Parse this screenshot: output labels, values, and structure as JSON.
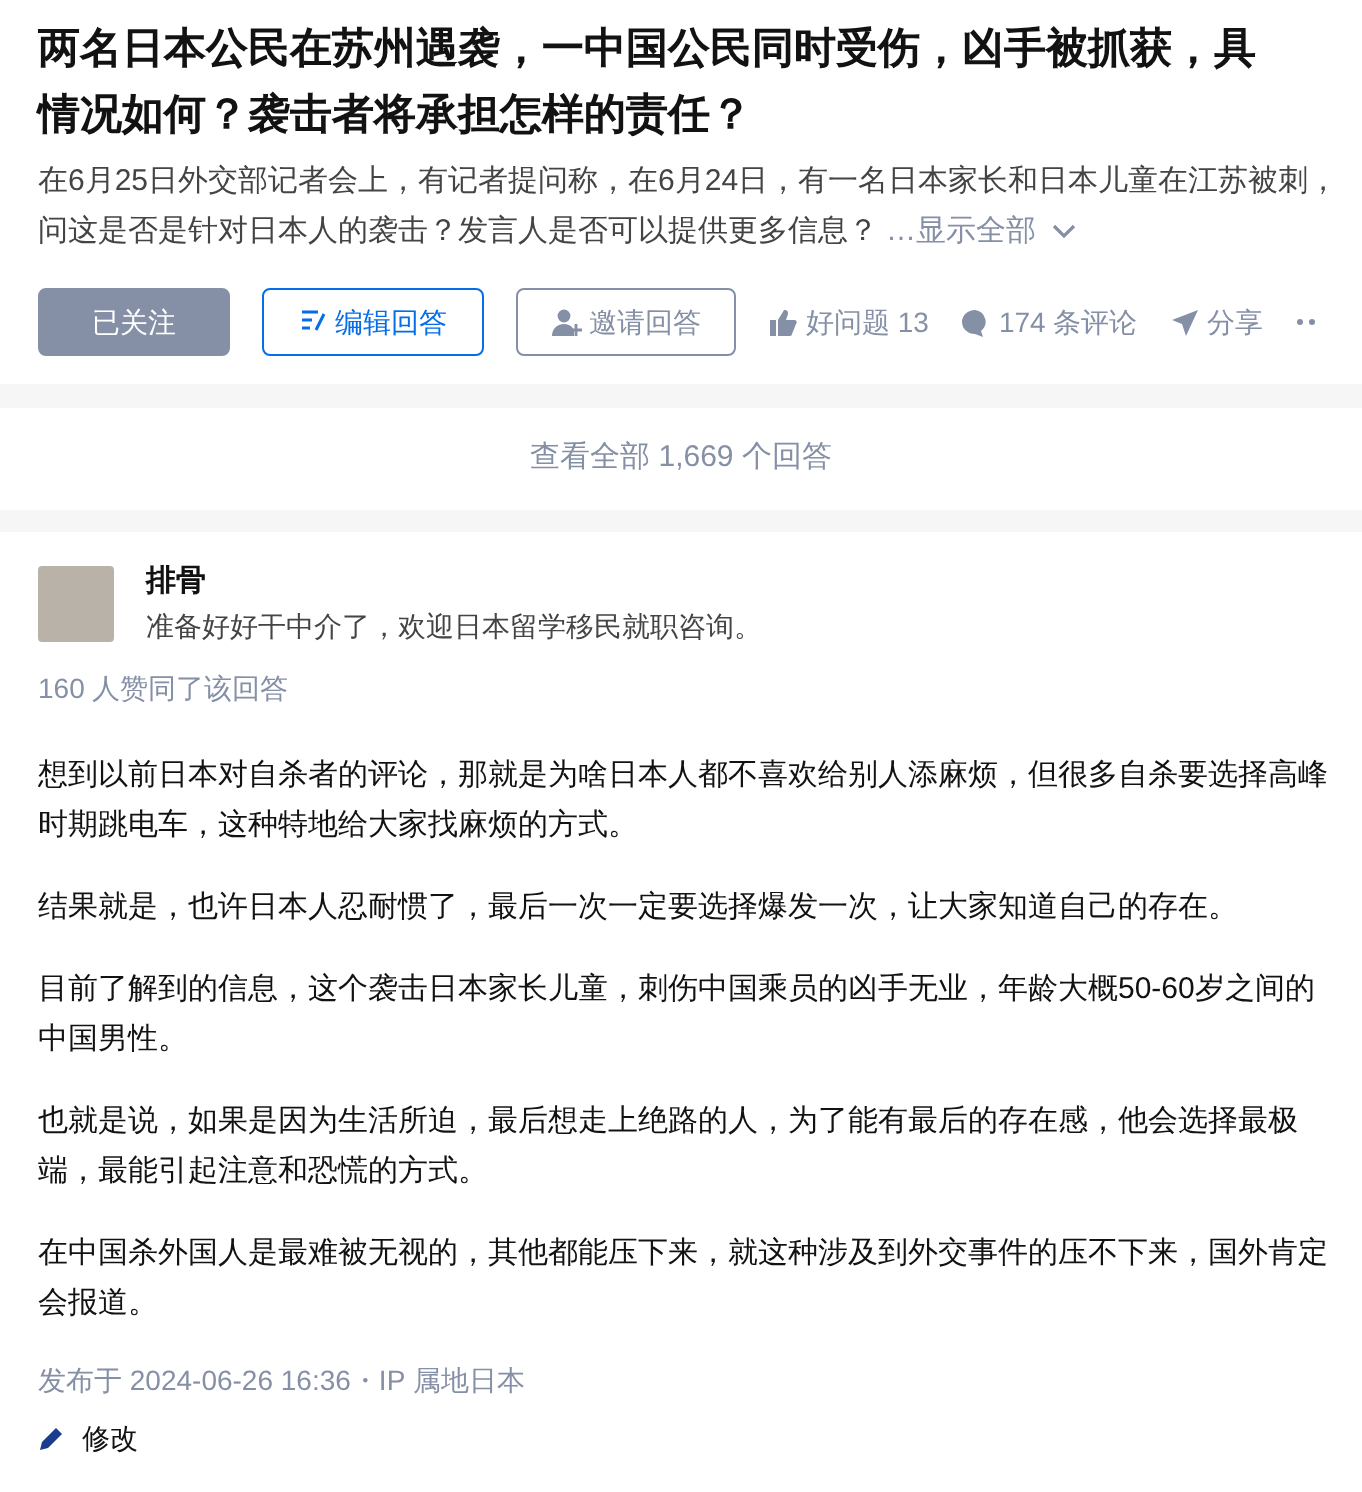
{
  "question": {
    "title_lines": [
      "两名日本公民在苏州遇袭，一中国公民同时受伤，凶手被抓获，具",
      "情况如何？袭击者将承担怎样的责任？"
    ],
    "detail_lines": [
      "在6月25日外交部记者会上，有记者提问称，在6月24日，有一名日本家长和日本儿童在江苏被刺，",
      "问这是否是针对日本人的袭击？发言人是否可以提供更多信息？"
    ],
    "show_all": "…显示全部",
    "follow": {
      "label": "已关注",
      "following": true
    },
    "edit_button": "编辑回答",
    "invite_button": "邀请回答",
    "actions": [
      {
        "kind": "like",
        "label": "好问题 13"
      },
      {
        "kind": "comment",
        "label": "174 条评论"
      },
      {
        "kind": "share",
        "label": "分享"
      }
    ]
  },
  "view_all": "查看全部 1,669 个回答",
  "answer": {
    "author": "排骨",
    "bio": "准备好好干中介了，欢迎日本留学移民就职咨询。",
    "votes": "160 人赞同了该回答",
    "paragraphs": [
      "想到以前日本对自杀者的评论，那就是为啥日本人都不喜欢给别人添麻烦，但很多自杀要选择高峰时期跳电车，这种特地给大家找麻烦的方式。",
      "结果就是，也许日本人忍耐惯了，最后一次一定要选择爆发一次，让大家知道自己的存在。",
      "目前了解到的信息，这个袭击日本家长儿童，刺伤中国乘员的凶手无业，年龄大概50-60岁之间的中国男性。",
      "也就是说，如果是因为生活所迫，最后想走上绝路的人，为了能有最后的存在感，他会选择最极端，最能引起注意和恐慌的方式。",
      "在中国杀外国人是最难被无视的，其他都能压下来，就这种涉及到外交事件的压不下来，国外肯定会报道。"
    ],
    "published": "发布于 2024-06-26 16:36・IP 属地日本",
    "edit_link": "修改"
  }
}
